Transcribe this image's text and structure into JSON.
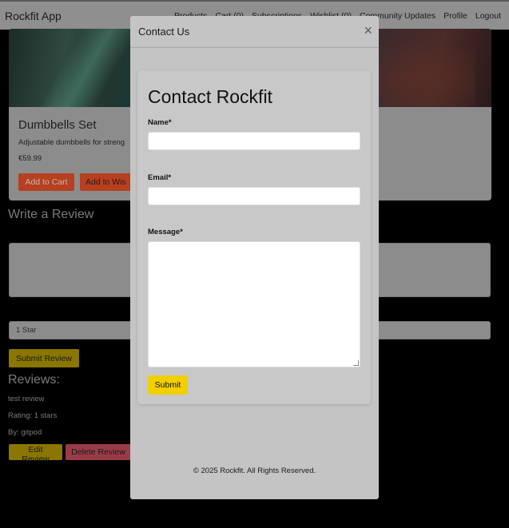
{
  "navbar": {
    "brand": "Rockfit App",
    "links": [
      "Products",
      "Cart (0)",
      "Subscriptions",
      "Wishlist (0)",
      "Community Updates",
      "Profile",
      "Logout"
    ]
  },
  "product": {
    "title": "Dumbbells Set",
    "description": "Adjustable dumbbells for streng",
    "price": "€59.99",
    "add_to_cart": "Add to Cart",
    "add_to_wishlist": "Add to Wis"
  },
  "review_form": {
    "heading": "Write a Review",
    "rating_selected": "1 Star",
    "submit_label": "Submit Review"
  },
  "reviews": {
    "heading": "Reviews:",
    "items": [
      {
        "text": "test review",
        "rating": "Rating: 1 stars",
        "by": "By: gitpod",
        "edit": "Edit Review",
        "delete": "Delete Review"
      }
    ]
  },
  "modal": {
    "title": "Contact Us",
    "close_glyph": "×",
    "form_title": "Contact Rockfit",
    "name_label": "Name*",
    "email_label": "Email*",
    "message_label": "Message*",
    "submit_label": "Submit",
    "footer": "© 2025 Rockfit. All Rights Reserved."
  },
  "colors": {
    "overlay_background": "#000000",
    "submit_accent": "#f2cf00",
    "add_to_cart": "#b6401f",
    "delete_review": "#9a3c48"
  }
}
